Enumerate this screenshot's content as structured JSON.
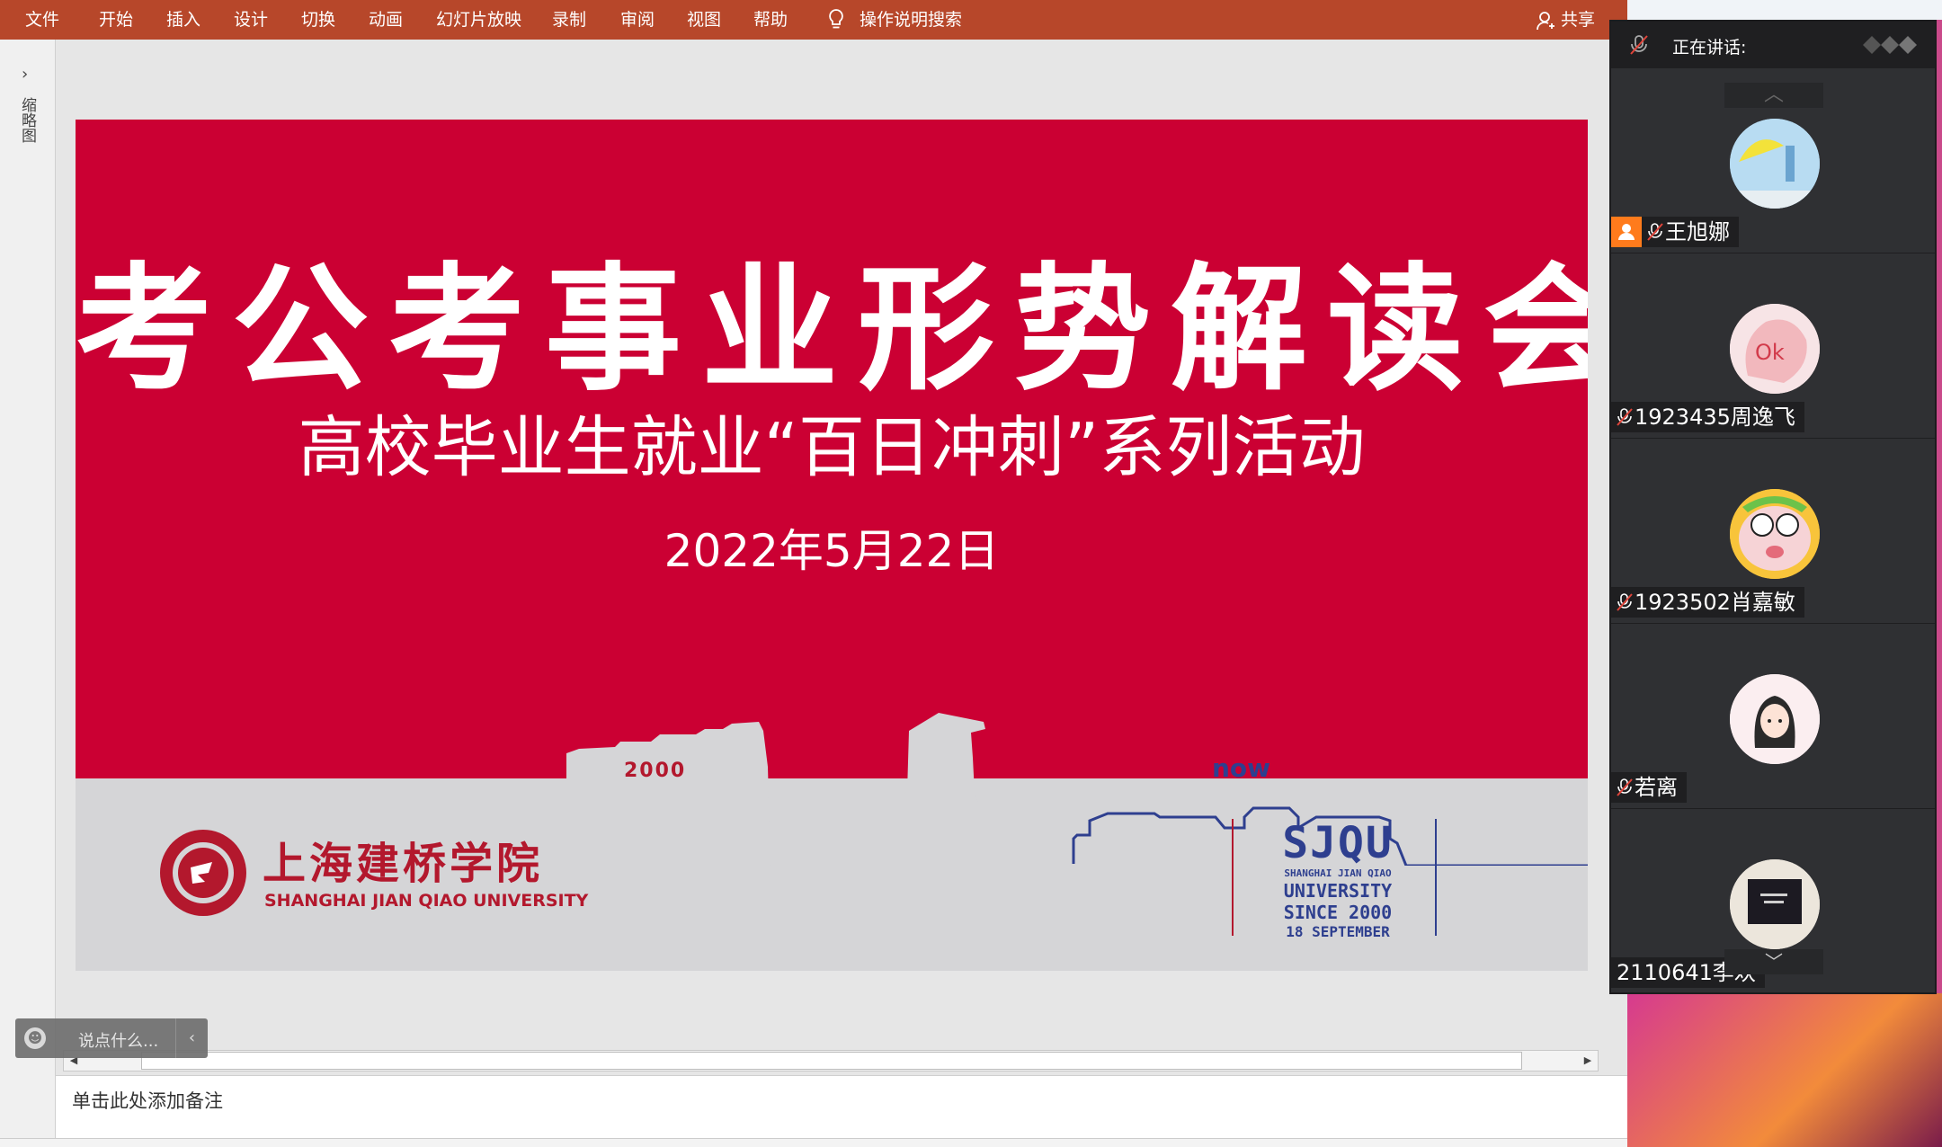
{
  "ribbon": {
    "tabs": [
      "文件",
      "开始",
      "插入",
      "设计",
      "切换",
      "动画",
      "幻灯片放映",
      "录制",
      "审阅",
      "视图",
      "帮助"
    ],
    "search_label": "操作说明搜索",
    "share_label": "共享"
  },
  "thumbnails": {
    "label": "缩略图",
    "expand_icon": "›"
  },
  "slide": {
    "title": "考公考事业形势解读会",
    "subtitle": "高校毕业生就业“百日冲刺”系列活动",
    "date": "2022年5月22日",
    "skyline_left_label": "2000",
    "skyline_right_label": "now",
    "university_name_cn": "上海建桥学院",
    "university_name_en": "SHANGHAI JIAN QIAO UNIVERSITY",
    "logo": {
      "abbr": "SJQU",
      "line1": "SHANGHAI JIAN QIAO",
      "line2": "UNIVERSITY",
      "line3": "SINCE 2000",
      "line4": "18 SEPTEMBER"
    }
  },
  "notes": {
    "placeholder": "单击此处添加备注"
  },
  "chat": {
    "placeholder": "说点什么..."
  },
  "video_panel": {
    "header_label": "正在讲话:",
    "participants": [
      {
        "name": "王旭娜",
        "host": true,
        "muted": true
      },
      {
        "name": "1923435周逸飞",
        "host": false,
        "muted": true
      },
      {
        "name": "1923502肖嘉敏",
        "host": false,
        "muted": true
      },
      {
        "name": "若离",
        "host": false,
        "muted": true
      },
      {
        "name": "2110641李欢",
        "host": false,
        "muted": false
      }
    ]
  },
  "colors": {
    "ribbon": "#b7472a",
    "slide_red": "#cb0033",
    "logo_blue": "#2e3f8f",
    "panel_bg": "#2f3033",
    "host_badge": "#ff7b1c"
  }
}
